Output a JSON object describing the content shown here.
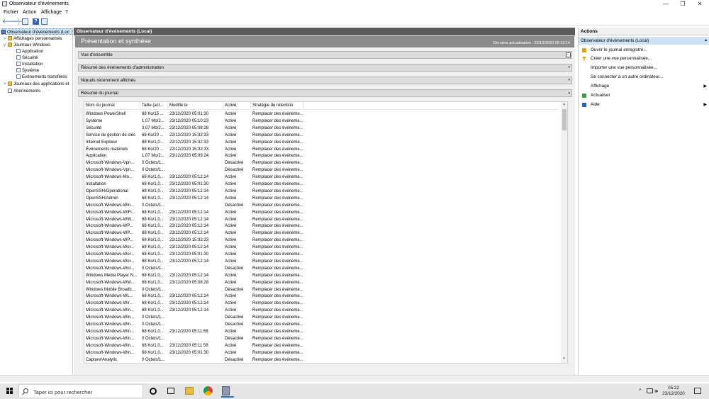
{
  "window": {
    "title": "Observateur d'événements",
    "controls": {
      "minimize": "—",
      "maximize": "❐",
      "close": "✕"
    }
  },
  "menu": [
    "Fichier",
    "Action",
    "Affichage",
    "?"
  ],
  "toolbar": {
    "back": "🡐",
    "forward": "🡒",
    "help": "?"
  },
  "tree": {
    "root": "Observateur d'événements (Loc",
    "items": [
      {
        "label": "Affichages personnalisés",
        "expand": ">"
      },
      {
        "label": "Journaux Windows",
        "expand": "v"
      },
      {
        "label": "Application"
      },
      {
        "label": "Sécurité"
      },
      {
        "label": "Installation"
      },
      {
        "label": "Système"
      },
      {
        "label": "Événements transférés"
      },
      {
        "label": "Journaux des applications et",
        "expand": ">"
      },
      {
        "label": "Abonnements"
      }
    ],
    "scroll": {
      "left": "<",
      "right": ">"
    }
  },
  "center": {
    "header": "Observateur d'événements (Local)",
    "banner_title": "Présentation et synthèse",
    "last_refresh": "Dernière actualisation : 23/12/2020 05:12:14",
    "sections": [
      {
        "label": "Vue d'ensemble",
        "marker": "−"
      },
      {
        "label": "Résumé des événements d'administration",
        "marker": "▾"
      },
      {
        "label": "Nœuds récemment affichés",
        "marker": "▾"
      },
      {
        "label": "Résumé du journal",
        "marker": "▴"
      }
    ],
    "table": {
      "columns": [
        "Nom du journal",
        "Taille (act...",
        "Modifié le",
        "Activé",
        "Stratégie de rétention"
      ],
      "rows": [
        [
          "Windows PowerShell",
          "68 Ko/15 ...",
          "23/12/2020 05:01:30",
          "Activé",
          "Remplacer des événeme..."
        ],
        [
          "Système",
          "1,07 Mo/2...",
          "23/12/2020 05:10:23",
          "Activé",
          "Remplacer des événeme..."
        ],
        [
          "Sécurité",
          "3,07 Mo/2...",
          "23/12/2020 05:08:28",
          "Activé",
          "Remplacer des événeme..."
        ],
        [
          "Service de gestion de clés",
          "68 Ko/20 ...",
          "22/12/2020 15:32:33",
          "Activé",
          "Remplacer des événeme..."
        ],
        [
          "Internet Explorer",
          "68 Ko/1,0...",
          "22/12/2020 15:32:33",
          "Activé",
          "Remplacer des événeme..."
        ],
        [
          "Événements matériels",
          "68 Ko/20 ...",
          "22/12/2020 15:32:33",
          "Activé",
          "Remplacer des événeme..."
        ],
        [
          "Application",
          "1,07 Mo/2...",
          "23/12/2020 05:09:24",
          "Activé",
          "Remplacer des événeme..."
        ],
        [
          "Microsoft-Windows-Vpn...",
          "0 Octets/1...",
          "",
          "Désactivé",
          "Remplacer des événeme..."
        ],
        [
          "Microsoft-Windows-Vpn...",
          "0 Octets/1...",
          "",
          "Désactivé",
          "Remplacer des événeme..."
        ],
        [
          "Microsoft-Windows-Mo...",
          "68 Ko/1,0...",
          "23/12/2020 05:12:14",
          "Activé",
          "Remplacer des événeme..."
        ],
        [
          "Installation",
          "68 Ko/1,0...",
          "23/12/2020 05:01:30",
          "Activé",
          "Remplacer des événeme..."
        ],
        [
          "OpenSSH/Operational",
          "68 Ko/1,0...",
          "23/12/2020 05:12:14",
          "Activé",
          "Remplacer des événeme..."
        ],
        [
          "OpenSSH/Admin",
          "68 Ko/1,0...",
          "23/12/2020 05:12:14",
          "Activé",
          "Remplacer des événeme..."
        ],
        [
          "Microsoft-Windows-Win...",
          "0 Octets/1...",
          "",
          "Désactivé",
          "Remplacer des événeme..."
        ],
        [
          "Microsoft-Windows-WiFi...",
          "68 Ko/1,0...",
          "23/12/2020 05:12:14",
          "Activé",
          "Remplacer des événeme..."
        ],
        [
          "Microsoft-Windows-WW...",
          "68 Ko/1,0...",
          "23/12/2020 05:12:14",
          "Activé",
          "Remplacer des événeme..."
        ],
        [
          "Microsoft-Windows-WP...",
          "68 Ko/1,0...",
          "23/12/2020 05:12:14",
          "Activé",
          "Remplacer des événeme..."
        ],
        [
          "Microsoft-Windows-WP...",
          "68 Ko/1,0...",
          "23/12/2020 05:12:14",
          "Activé",
          "Remplacer des événeme..."
        ],
        [
          "Microsoft-Windows-WP...",
          "68 Ko/1,0...",
          "22/12/2020 15:32:33",
          "Activé",
          "Remplacer des événeme..."
        ],
        [
          "Microsoft-Windows-Wor...",
          "68 Ko/1,0...",
          "23/12/2020 05:12:14",
          "Activé",
          "Remplacer des événeme..."
        ],
        [
          "Microsoft-Windows-Wor...",
          "68 Ko/1,0...",
          "23/12/2020 05:01:30",
          "Activé",
          "Remplacer des événeme..."
        ],
        [
          "Microsoft-Windows-Wor...",
          "68 Ko/1,0...",
          "23/12/2020 05:12:14",
          "Activé",
          "Remplacer des événeme..."
        ],
        [
          "Microsoft-Windows-Wor...",
          "0 Octets/1...",
          "",
          "Désactivé",
          "Remplacer des événeme..."
        ],
        [
          "Windows Media Player N...",
          "68 Ko/1,0...",
          "23/12/2020 05:12:14",
          "Activé",
          "Remplacer des événeme..."
        ],
        [
          "Microsoft-Windows-WM...",
          "68 Ko/1,0...",
          "23/12/2020 05:08:28",
          "Activé",
          "Remplacer des événeme..."
        ],
        [
          "Windows Mobile Broadb...",
          "0 Octets/1...",
          "",
          "Désactivé",
          "Remplacer des événeme..."
        ],
        [
          "Microsoft-Windows-WL...",
          "68 Ko/1,0...",
          "23/12/2020 05:12:14",
          "Activé",
          "Remplacer des événeme..."
        ],
        [
          "Microsoft-Windows-Wir...",
          "68 Ko/1,0...",
          "23/12/2020 05:12:14",
          "Activé",
          "Remplacer des événeme..."
        ],
        [
          "Microsoft-Windows-Win...",
          "68 Ko/1,0...",
          "23/12/2020 05:12:14",
          "Activé",
          "Remplacer des événeme..."
        ],
        [
          "Microsoft-Windows-Win...",
          "0 Octets/1...",
          "",
          "Désactivé",
          "Remplacer des événeme..."
        ],
        [
          "Microsoft-Windows-Win...",
          "0 Octets/1...",
          "",
          "Désactivé",
          "Remplacer des événeme..."
        ],
        [
          "Microsoft-Windows-Win...",
          "68 Ko/1,0...",
          "23/12/2020 05:11:58",
          "Activé",
          "Remplacer des événeme..."
        ],
        [
          "Microsoft-Windows-Win...",
          "0 Octets/1...",
          "",
          "Désactivé",
          "Remplacer des événeme..."
        ],
        [
          "Microsoft-Windows-Win...",
          "68 Ko/1,0...",
          "23/12/2020 05:11:58",
          "Activé",
          "Remplacer des événeme..."
        ],
        [
          "Microsoft-Windows-Win...",
          "68 Ko/1,0...",
          "23/12/2020 05:01:30",
          "Activé",
          "Remplacer des événeme..."
        ],
        [
          "Capture/Analytic",
          "0 Octets/1...",
          "",
          "Désactivé",
          "Remplacer des événeme..."
        ]
      ]
    }
  },
  "actions": {
    "header": "Actions",
    "group": "Observateur d'événements (Local)",
    "items": [
      {
        "label": "Ouvrir le journal enregistré...",
        "icon": "open-log-icon",
        "color": "#d9a520"
      },
      {
        "label": "Créer une vue personnalisée...",
        "icon": "filter-icon",
        "color": "#d9a520"
      },
      {
        "label": "Importer une vue personnalisée...",
        "icon": "",
        "color": ""
      },
      {
        "label": "Se connecter à un autre ordinateur...",
        "icon": "",
        "color": ""
      },
      {
        "label": "Affichage",
        "icon": "",
        "color": "",
        "submenu": "▶"
      },
      {
        "label": "Actualiser",
        "icon": "refresh-icon",
        "color": "#3a9a3a"
      },
      {
        "label": "Aide",
        "icon": "help-icon",
        "color": "#2c5fb4",
        "submenu": "▶"
      }
    ]
  },
  "taskbar": {
    "search_placeholder": "Taper ici pour rechercher",
    "tray": {
      "chevron": "^",
      "volume": "🕪"
    },
    "time": "05:22",
    "date": "23/12/2020"
  }
}
